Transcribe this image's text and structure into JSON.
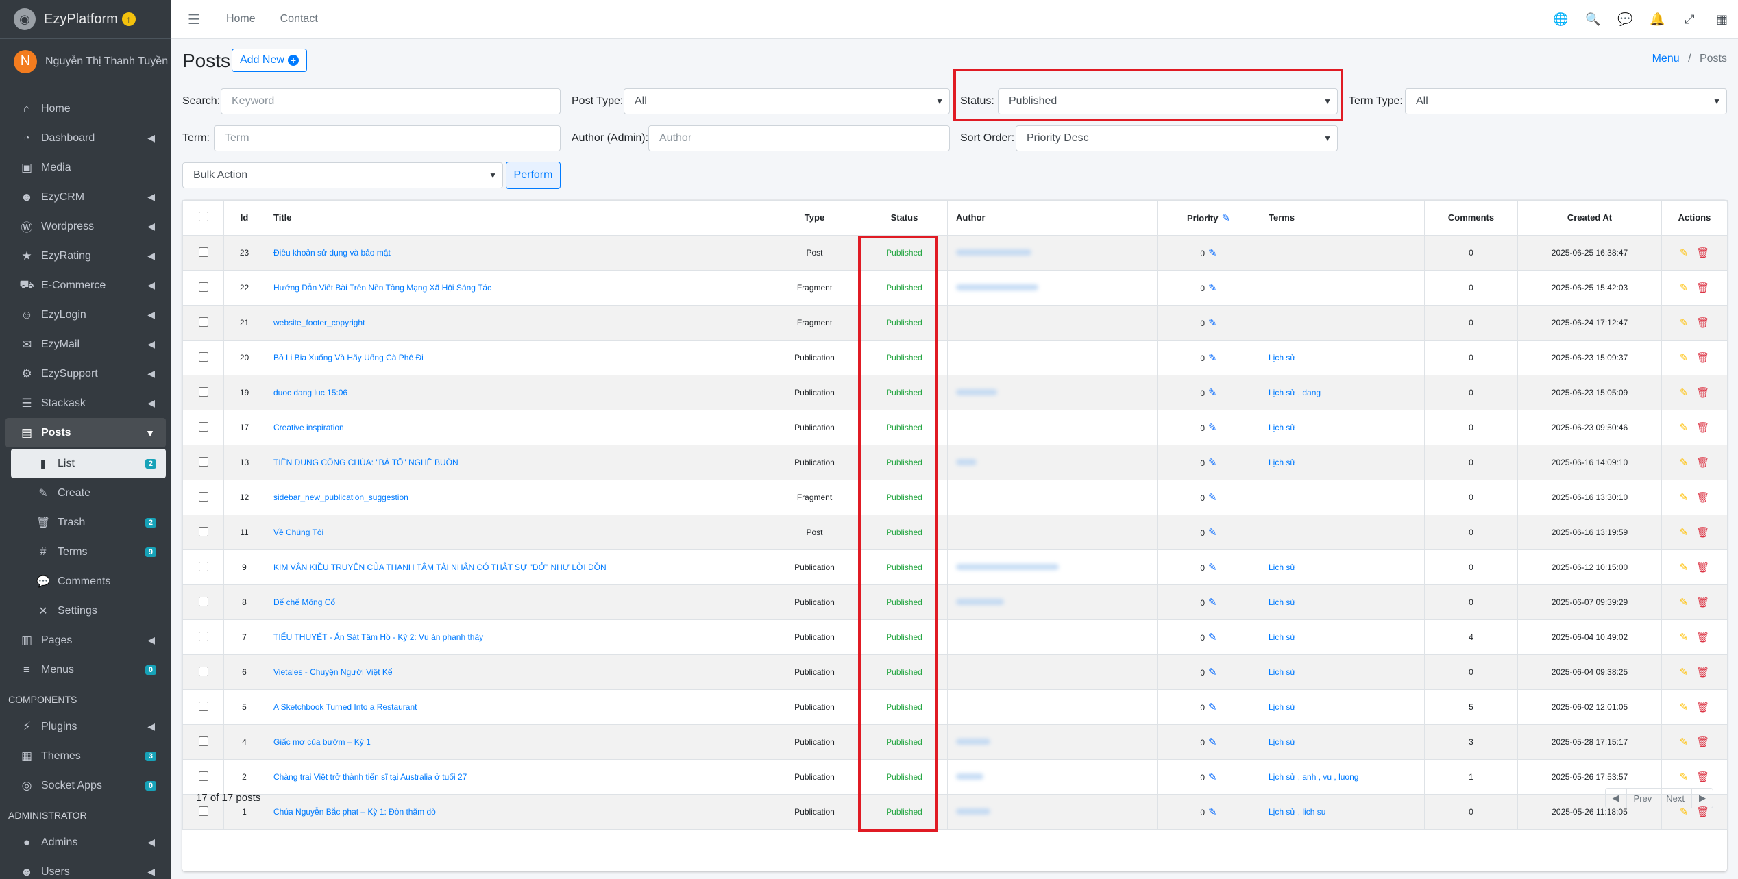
{
  "brand": {
    "name": "EzyPlatform"
  },
  "user": {
    "initial": "N",
    "name": "Nguyễn Thị Thanh Tuyền"
  },
  "sidebar": {
    "items": [
      {
        "label": "Home"
      },
      {
        "label": "Dashboard"
      },
      {
        "label": "Media"
      },
      {
        "label": "EzyCRM"
      },
      {
        "label": "Wordpress"
      },
      {
        "label": "EzyRating"
      },
      {
        "label": "E-Commerce"
      },
      {
        "label": "EzyLogin"
      },
      {
        "label": "EzyMail"
      },
      {
        "label": "EzySupport"
      },
      {
        "label": "Stackask"
      },
      {
        "label": "Posts"
      }
    ],
    "posts_sub": [
      {
        "label": "List",
        "badge": "2"
      },
      {
        "label": "Create"
      },
      {
        "label": "Trash",
        "badge": "2"
      },
      {
        "label": "Terms",
        "badge": "9"
      },
      {
        "label": "Comments"
      },
      {
        "label": "Settings"
      }
    ],
    "pages": {
      "label": "Pages"
    },
    "menus": {
      "label": "Menus",
      "badge": "0"
    },
    "components_header": "COMPONENTS",
    "plugins": {
      "label": "Plugins"
    },
    "themes": {
      "label": "Themes",
      "badge": "3"
    },
    "socket_apps": {
      "label": "Socket Apps",
      "badge": "0"
    },
    "admin_header": "ADMINISTRATOR",
    "admins": {
      "label": "Admins"
    },
    "users": {
      "label": "Users"
    }
  },
  "topbar": {
    "home": "Home",
    "contact": "Contact"
  },
  "page": {
    "title": "Posts",
    "add_new": "Add New"
  },
  "breadcrumb": {
    "menu": "Menu",
    "sep": "/",
    "current": "Posts"
  },
  "filters": {
    "search_label": "Search:",
    "search_placeholder": "Keyword",
    "post_type_label": "Post Type:",
    "post_type_value": "All",
    "status_label": "Status:",
    "status_value": "Published",
    "term_type_label": "Term Type:",
    "term_type_value": "All",
    "term_label": "Term:",
    "term_placeholder": "Term",
    "author_label": "Author (Admin):",
    "author_placeholder": "Author",
    "sort_label": "Sort Order:",
    "sort_value": "Priority Desc",
    "bulk_value": "Bulk Action",
    "perform": "Perform"
  },
  "table": {
    "headers": {
      "id": "Id",
      "title": "Title",
      "type": "Type",
      "status": "Status",
      "author": "Author",
      "priority": "Priority",
      "terms": "Terms",
      "comments": "Comments",
      "created": "Created At",
      "actions": "Actions"
    },
    "rows": [
      {
        "id": "23",
        "title": "Điều khoản sử dụng và bảo mật",
        "type": "Post",
        "status": "Published",
        "priority": "0",
        "terms": "",
        "comments": "0",
        "created": "2025-06-25 16:38:47"
      },
      {
        "id": "22",
        "title": "Hướng Dẫn Viết Bài Trên Nền Tảng Mạng Xã Hội Sáng Tác",
        "type": "Fragment",
        "status": "Published",
        "priority": "0",
        "terms": "",
        "comments": "0",
        "created": "2025-06-25 15:42:03"
      },
      {
        "id": "21",
        "title": "website_footer_copyright",
        "type": "Fragment",
        "status": "Published",
        "priority": "0",
        "terms": "",
        "comments": "0",
        "created": "2025-06-24 17:12:47"
      },
      {
        "id": "20",
        "title": "Bỏ Li Bia Xuống Và Hãy Uống Cà Phê Đi",
        "type": "Publication",
        "status": "Published",
        "priority": "0",
        "terms": "Lịch sử",
        "comments": "0",
        "created": "2025-06-23 15:09:37"
      },
      {
        "id": "19",
        "title": "duoc dang luc 15:06",
        "type": "Publication",
        "status": "Published",
        "priority": "0",
        "terms": "Lịch sử , dang",
        "comments": "0",
        "created": "2025-06-23 15:05:09"
      },
      {
        "id": "17",
        "title": "Creative inspiration",
        "type": "Publication",
        "status": "Published",
        "priority": "0",
        "terms": "Lịch sử",
        "comments": "0",
        "created": "2025-06-23 09:50:46"
      },
      {
        "id": "13",
        "title": "TIÊN DUNG CÔNG CHÚA: \"BÀ TỔ\" NGHỀ BUÔN",
        "type": "Publication",
        "status": "Published",
        "priority": "0",
        "terms": "Lịch sử",
        "comments": "0",
        "created": "2025-06-16 14:09:10"
      },
      {
        "id": "12",
        "title": "sidebar_new_publication_suggestion",
        "type": "Fragment",
        "status": "Published",
        "priority": "0",
        "terms": "",
        "comments": "0",
        "created": "2025-06-16 13:30:10"
      },
      {
        "id": "11",
        "title": "Về Chúng Tôi",
        "type": "Post",
        "status": "Published",
        "priority": "0",
        "terms": "",
        "comments": "0",
        "created": "2025-06-16 13:19:59"
      },
      {
        "id": "9",
        "title": "KIM VÂN KIỀU TRUYỆN CỦA THANH TÂM TÀI NHÂN CÓ THẬT SỰ \"DỞ\" NHƯ LỜI ĐỒN",
        "type": "Publication",
        "status": "Published",
        "priority": "0",
        "terms": "Lịch sử",
        "comments": "0",
        "created": "2025-06-12 10:15:00"
      },
      {
        "id": "8",
        "title": "Đế chế Mông Cổ",
        "type": "Publication",
        "status": "Published",
        "priority": "0",
        "terms": "Lịch sử",
        "comments": "0",
        "created": "2025-06-07 09:39:29"
      },
      {
        "id": "7",
        "title": "TIỂU THUYẾT - Án Sát Tâm Hồ - Kỳ 2: Vụ án phanh thây",
        "type": "Publication",
        "status": "Published",
        "priority": "0",
        "terms": "Lịch sử",
        "comments": "4",
        "created": "2025-06-04 10:49:02"
      },
      {
        "id": "6",
        "title": "Vietales - Chuyện Người Việt Kể",
        "type": "Publication",
        "status": "Published",
        "priority": "0",
        "terms": "Lịch sử",
        "comments": "0",
        "created": "2025-06-04 09:38:25"
      },
      {
        "id": "5",
        "title": "A Sketchbook Turned Into a Restaurant",
        "type": "Publication",
        "status": "Published",
        "priority": "0",
        "terms": "Lịch sử",
        "comments": "5",
        "created": "2025-06-02 12:01:05"
      },
      {
        "id": "4",
        "title": "Giấc mơ của bướm – Kỳ 1",
        "type": "Publication",
        "status": "Published",
        "priority": "0",
        "terms": "Lịch sử",
        "comments": "3",
        "created": "2025-05-28 17:15:17"
      },
      {
        "id": "2",
        "title": "Chàng trai Việt trở thành tiến sĩ tại Australia ở tuổi 27",
        "type": "Publication",
        "status": "Published",
        "priority": "0",
        "terms": "Lịch sử , anh , vu , luong",
        "comments": "1",
        "created": "2025-05-26 17:53:57"
      },
      {
        "id": "1",
        "title": "Chúa Nguyễn Bắc phạt – Kỳ 1: Đòn thăm dò",
        "type": "Publication",
        "status": "Published",
        "priority": "0",
        "terms": "Lịch sử , lich su",
        "comments": "0",
        "created": "2025-05-26 11:18:05"
      }
    ]
  },
  "footer": {
    "count": "17 of 17 posts",
    "prev": "Prev",
    "next": "Next"
  },
  "colors": {
    "highlight": "#e01b24",
    "status": "#28a745",
    "link": "#007bff",
    "sidebar": "#343a40"
  }
}
